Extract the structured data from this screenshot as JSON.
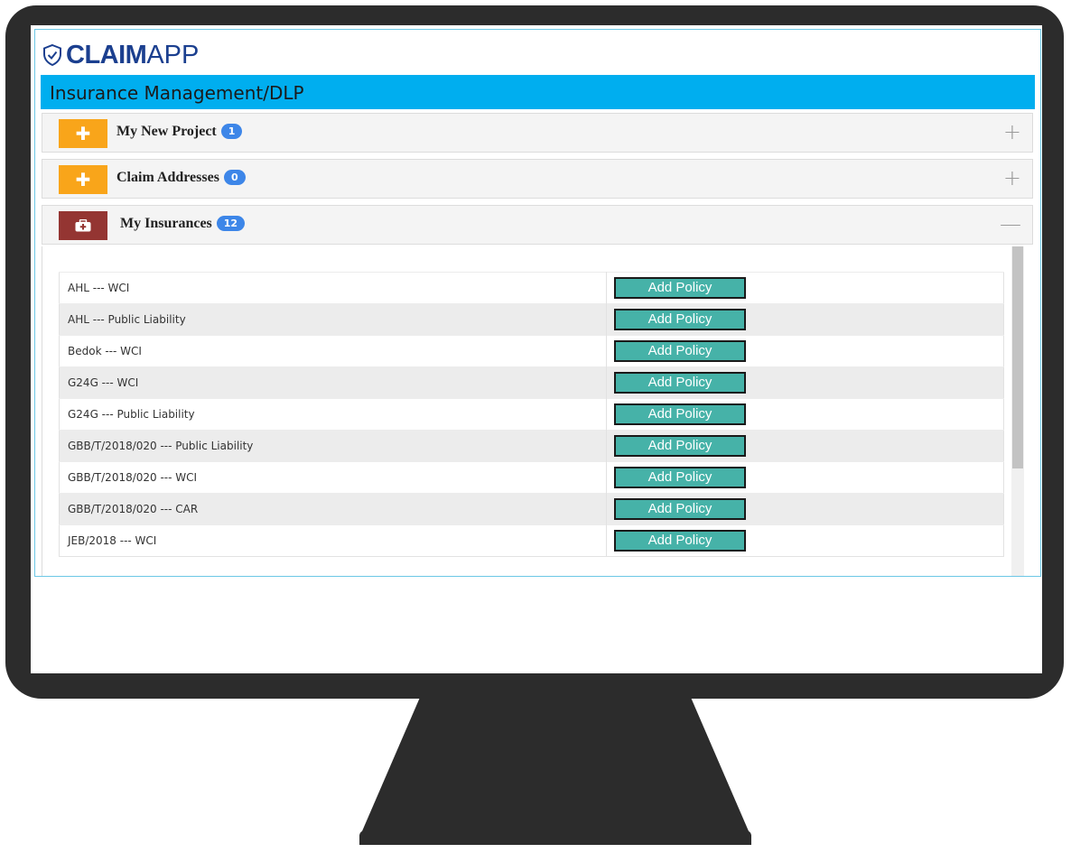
{
  "app": {
    "logo_strong": "CLAIM",
    "logo_light": "APP",
    "page_title": "Insurance Management/DLP"
  },
  "panels": [
    {
      "title": "My New Project",
      "badge": "1",
      "icon": "plus-icon",
      "toggle": "+",
      "state": "collapsed",
      "color": "#f9a51a"
    },
    {
      "title": "Claim Addresses",
      "badge": "0",
      "icon": "plus-icon",
      "toggle": "+",
      "state": "collapsed",
      "color": "#f9a51a"
    },
    {
      "title": "My Insurances",
      "badge": "12",
      "icon": "medical-kit-icon",
      "toggle": "—",
      "state": "expanded",
      "color": "#943532"
    }
  ],
  "policies": {
    "button_label": "Add Policy",
    "rows": [
      "AHL --- WCI",
      "AHL --- Public Liability",
      "Bedok --- WCI",
      "G24G --- WCI",
      "G24G --- Public Liability",
      "GBB/T/2018/020 --- Public Liability",
      "GBB/T/2018/020 --- WCI",
      "GBB/T/2018/020 --- CAR",
      "JEB/2018 --- WCI"
    ]
  },
  "colors": {
    "title_bar": "#00aeef",
    "logo": "#1b3f8f",
    "badge": "#3d86e8",
    "button": "#46b2a8"
  }
}
